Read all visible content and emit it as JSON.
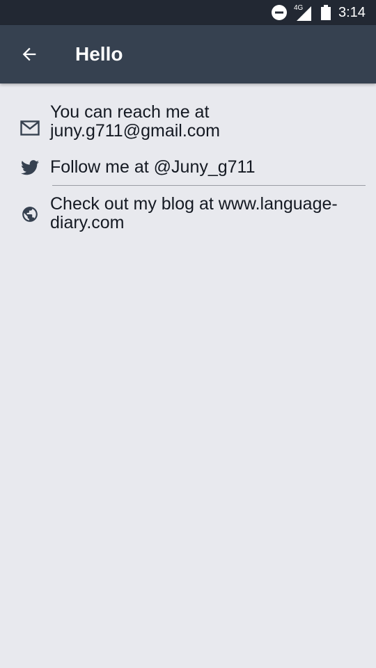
{
  "status_bar": {
    "network": "4G",
    "time": "3:14"
  },
  "app_bar": {
    "title": "Hello"
  },
  "contacts": {
    "email_line1": "You can reach me at",
    "email_line2": "juny.g711@gmail.com",
    "twitter": "Follow me at @Juny_g711",
    "blog_line1": "Check out my blog at www.language-",
    "blog_line2": "diary.com"
  },
  "icons": {
    "email": "envelope-icon",
    "twitter": "twitter-bird-icon",
    "blog": "globe-icon",
    "back": "arrow-left-icon"
  },
  "colors": {
    "status_bar": "#222833",
    "app_bar": "#364150",
    "background": "#e8e9ee",
    "icon": "#364150",
    "text": "#141922"
  }
}
